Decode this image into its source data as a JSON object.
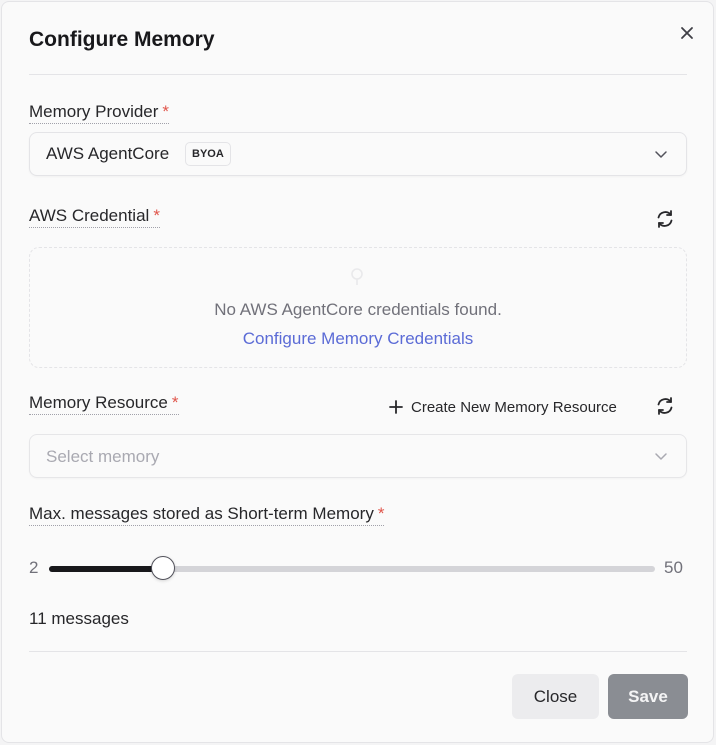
{
  "dialog": {
    "title": "Configure Memory"
  },
  "provider": {
    "label": "Memory Provider",
    "required": "*",
    "value": "AWS AgentCore",
    "badge": "BYOA"
  },
  "credential": {
    "label": "AWS Credential",
    "required": "*",
    "empty_message": "No AWS AgentCore credentials found.",
    "configure_link": "Configure Memory Credentials"
  },
  "resource": {
    "label": "Memory Resource",
    "required": "*",
    "create_label": "Create New Memory Resource",
    "placeholder": "Select memory"
  },
  "short_term": {
    "label": "Max. messages stored as Short-term Memory",
    "required": "*",
    "min_label": "2",
    "max_label": "50",
    "min": 2,
    "max": 50,
    "value": 11,
    "count_text": "11 messages"
  },
  "footer": {
    "close_label": "Close",
    "save_label": "Save"
  },
  "colors": {
    "accent_link": "#5b6bd6",
    "required": "#e0554b",
    "save_disabled": "#8a8d93"
  }
}
